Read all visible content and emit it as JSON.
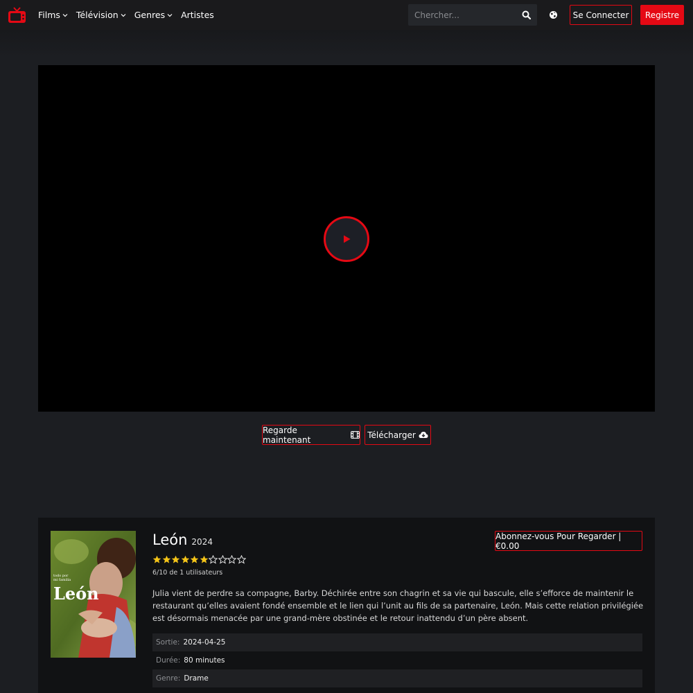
{
  "header": {
    "nav": [
      {
        "label": "Films",
        "dropdown": true
      },
      {
        "label": "Télévision",
        "dropdown": true
      },
      {
        "label": "Genres",
        "dropdown": true
      },
      {
        "label": "Artistes",
        "dropdown": false
      }
    ],
    "search_placeholder": "Chercher...",
    "login_label": "Se Connecter",
    "register_label": "Registre",
    "icons": [
      "tv-logo-icon",
      "chevron-down-icon",
      "search-icon",
      "globe-icon"
    ]
  },
  "actions": {
    "watch_label": "Regarde maintenant",
    "download_label": "Télécharger"
  },
  "movie": {
    "title": "León",
    "year": "2024",
    "subscribe_label": "Abonnez-vous Pour Regarder | €0.00",
    "rating": 6,
    "rating_max": 10,
    "rating_text": "6/10 de 1 utilisateurs",
    "synopsis": "Julia vient de perdre sa compagne, Barby. Déchirée entre son chagrin et sa vie qui bascule, elle s’efforce de maintenir le restaurant qu’elles avaient fondé ensemble et le lien qui l’unit au fils de sa partenaire, León. Mais cette relation privilégiée est désormais menacée par une grand-mère obstinée et le retour inattendu d’un père absent.",
    "poster_title": "León",
    "meta": [
      {
        "label": "Sortie:",
        "value": "2024-04-25"
      },
      {
        "label": "Durée:",
        "value": "80 minutes"
      },
      {
        "label": "Genre:",
        "value": "Drame"
      }
    ]
  },
  "colors": {
    "accent": "#e50914",
    "background": "#1c1e22",
    "panel": "#111214",
    "star": "#f5c518"
  }
}
